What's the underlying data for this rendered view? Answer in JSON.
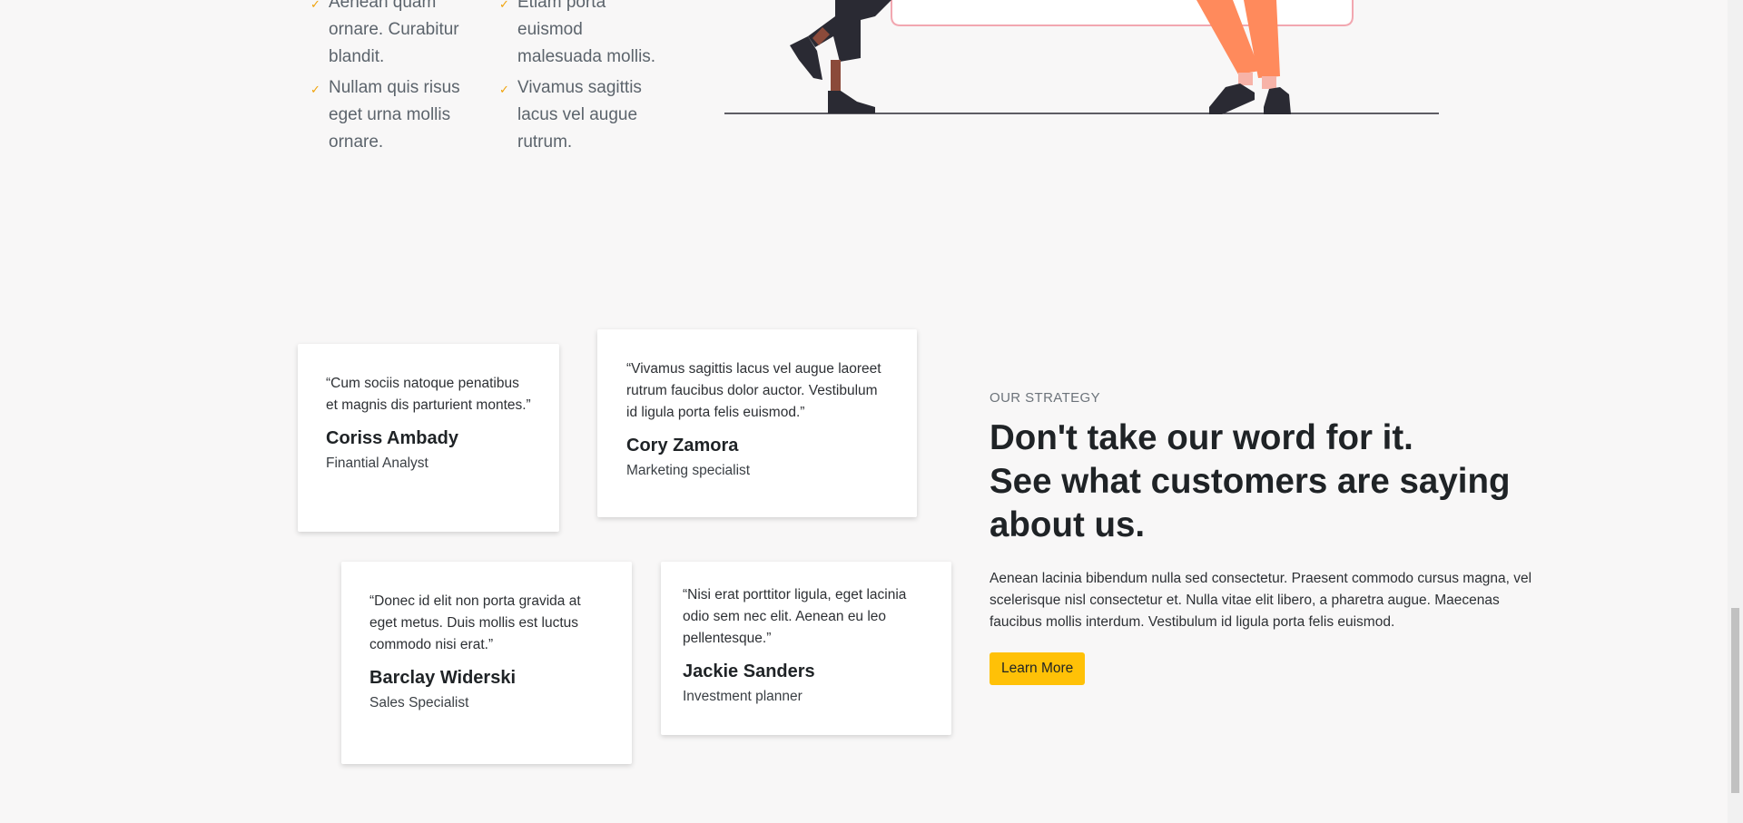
{
  "features": {
    "column_1": [
      "Aenean quam ornare. Curabitur blandit.",
      "Nullam quis risus eget urna mollis ornare."
    ],
    "column_2": [
      "Etiam porta euismod malesuada mollis.",
      "Vivamus sagittis lacus vel augue rutrum."
    ],
    "check_icon": "check-icon",
    "accent_color": "#f0a30a"
  },
  "testimonials": [
    {
      "quote": "“Cum sociis natoque penatibus et magnis dis parturient montes.”",
      "name": "Coriss Ambady",
      "role": "Finantial Analyst"
    },
    {
      "quote": "“Vivamus sagittis lacus vel augue laoreet rutrum faucibus dolor auctor. Vestibulum id ligula porta felis euismod.”",
      "name": "Cory Zamora",
      "role": "Marketing specialist"
    },
    {
      "quote": "“Donec id elit non porta gravida at eget metus. Duis mollis est luctus commodo nisi erat.”",
      "name": "Barclay Widerski",
      "role": "Sales Specialist"
    },
    {
      "quote": "“Nisi erat porttitor ligula, eget lacinia odio sem nec elit. Aenean eu leo pellentesque.”",
      "name": "Jackie Sanders",
      "role": "Investment planner"
    }
  ],
  "strategy": {
    "eyebrow": "OUR STRATEGY",
    "headline_line_1": "Don't take our word for it.",
    "headline_line_2": "See what customers are saying about us.",
    "body": "Aenean lacinia bibendum nulla sed consectetur. Praesent commodo cursus magna, vel scelerisque nisl consectetur et. Nulla vitae elit libero, a pharetra augue. Maecenas faucibus mollis interdum. Vestibulum id ligula porta felis euismod.",
    "button_label": "Learn More",
    "button_color": "#ffc107"
  },
  "colors": {
    "page_background": "#f8f7f7",
    "illustration_orange": "#ff8a5c",
    "illustration_pink": "#f2a7b0",
    "illustration_dark": "#2a2a33"
  }
}
